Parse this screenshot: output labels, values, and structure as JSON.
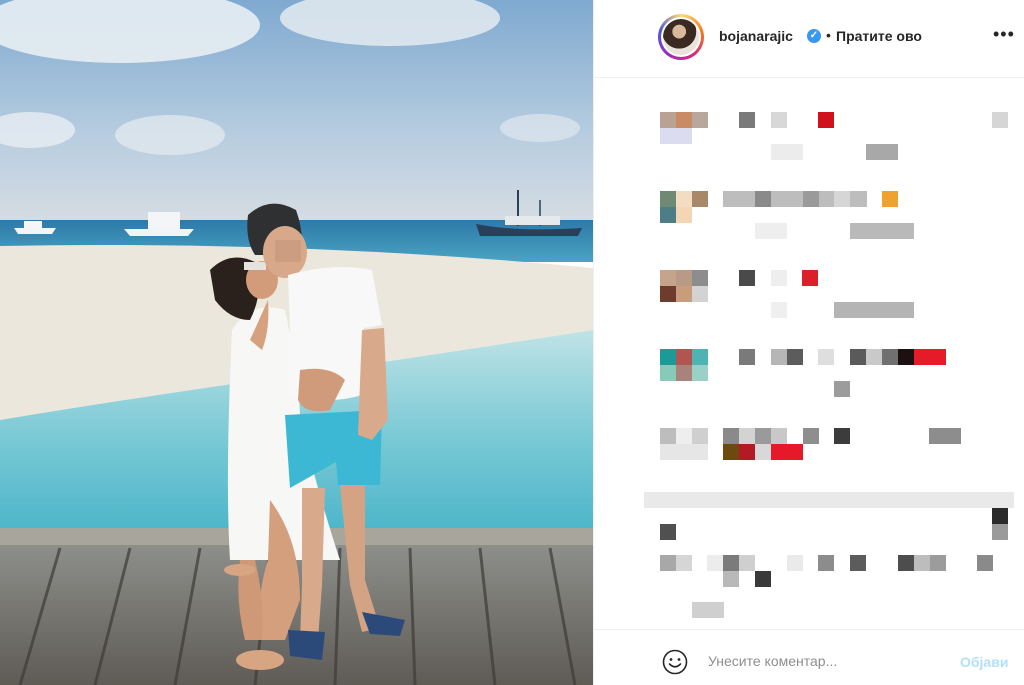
{
  "post": {
    "username": "bojanarajic",
    "verified_icon": "verified-badge-icon",
    "separator": "•",
    "follow_label": "Пратите ово",
    "more_icon": "more-options-icon",
    "more_glyph": "•••"
  },
  "comment_box": {
    "emoji_icon": "emoji-smile-icon",
    "placeholder": "Унесите коментар...",
    "post_label": "Објави"
  },
  "colors": {
    "accent": "#3897f0",
    "post_button_disabled": "#b2dffc"
  }
}
